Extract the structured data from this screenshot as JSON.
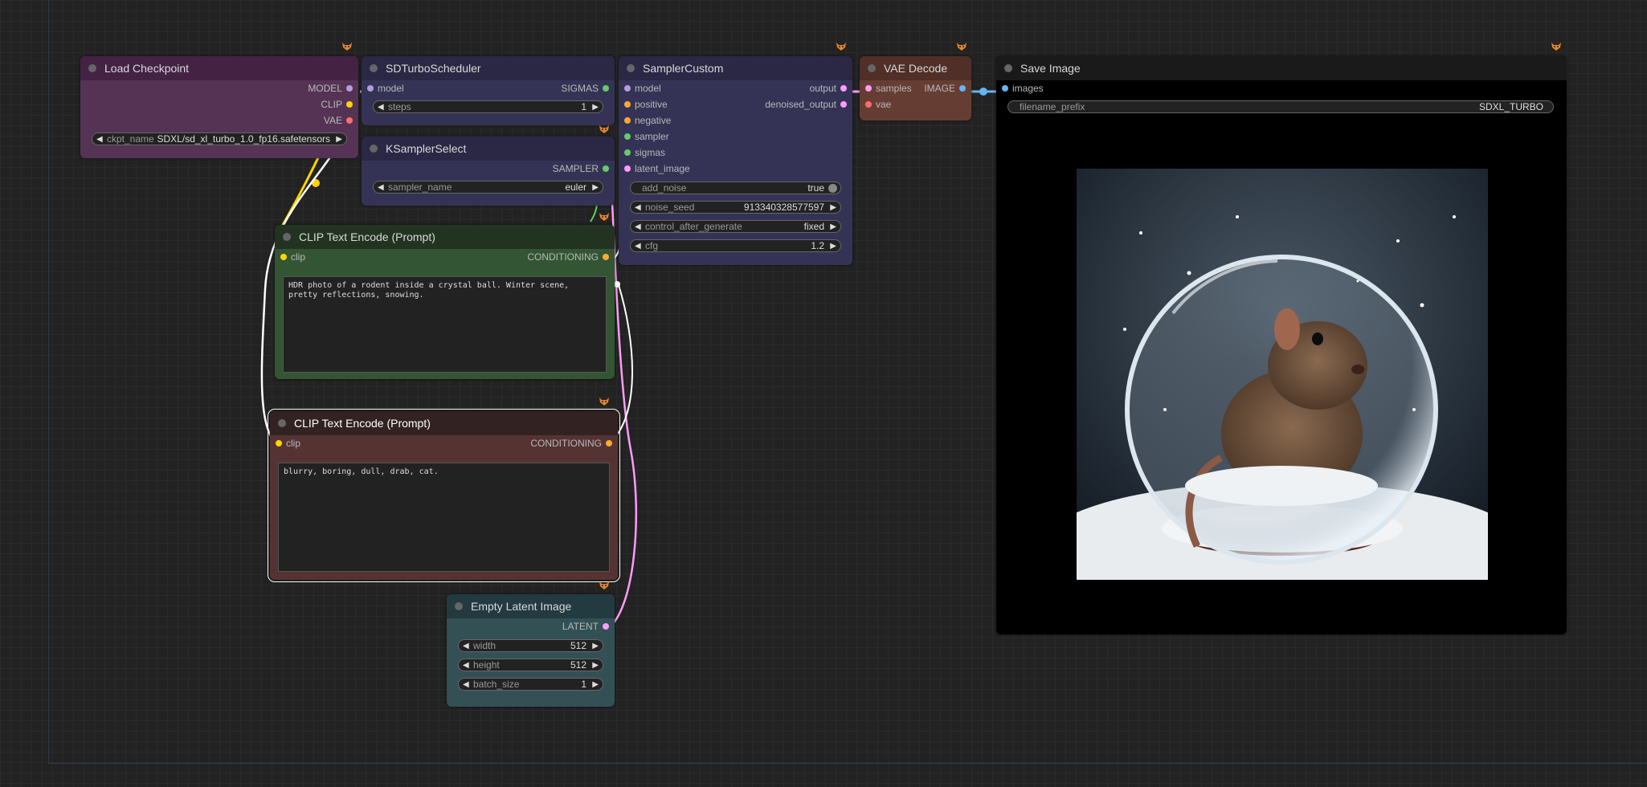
{
  "nodes": {
    "load_checkpoint": {
      "title": "Load Checkpoint",
      "outputs": [
        "MODEL",
        "CLIP",
        "VAE"
      ],
      "widget": {
        "name": "ckpt_name",
        "value": "SDXL/sd_xl_turbo_1.0_fp16.safetensors"
      }
    },
    "sd_turbo_scheduler": {
      "title": "SDTurboScheduler",
      "input": "model",
      "output": "SIGMAS",
      "widget": {
        "name": "steps",
        "value": "1"
      }
    },
    "ksampler_select": {
      "title": "KSamplerSelect",
      "output": "SAMPLER",
      "widget": {
        "name": "sampler_name",
        "value": "euler"
      }
    },
    "sampler_custom": {
      "title": "SamplerCustom",
      "inputs": [
        "model",
        "positive",
        "negative",
        "sampler",
        "sigmas",
        "latent_image"
      ],
      "outputs": [
        "output",
        "denoised_output"
      ],
      "widgets": [
        {
          "name": "add_noise",
          "value": "true"
        },
        {
          "name": "noise_seed",
          "value": "913340328577597"
        },
        {
          "name": "control_after_generate",
          "value": "fixed"
        },
        {
          "name": "cfg",
          "value": "1.2"
        }
      ]
    },
    "vae_decode": {
      "title": "VAE Decode",
      "inputs": [
        "samples",
        "vae"
      ],
      "output": "IMAGE"
    },
    "save_image": {
      "title": "Save Image",
      "input": "images",
      "widget": {
        "name": "filename_prefix",
        "value": "SDXL_TURBO"
      },
      "preview_icon": "snow-globe-rodent-image"
    },
    "clip_positive": {
      "title": "CLIP Text Encode (Prompt)",
      "input": "clip",
      "output": "CONDITIONING",
      "text": "HDR photo of a rodent inside a crystal ball. Winter scene, pretty reflections, snowing."
    },
    "clip_negative": {
      "title": "CLIP Text Encode (Prompt)",
      "input": "clip",
      "output": "CONDITIONING",
      "text": "blurry, boring, dull, drab, cat."
    },
    "empty_latent": {
      "title": "Empty Latent Image",
      "output": "LATENT",
      "widgets": [
        {
          "name": "width",
          "value": "512"
        },
        {
          "name": "height",
          "value": "512"
        },
        {
          "name": "batch_size",
          "value": "1"
        }
      ]
    }
  },
  "colors": {
    "canvas_bg": "#222222",
    "model_pin": "#b39ddb",
    "clip_pin": "#ffd500",
    "vae_pin": "#ff6e6e",
    "conditioning_pin": "#ffa931",
    "latent_pin": "#ff9cf9",
    "image_pin": "#64b5f6",
    "sigmas_pin": "#66cc66"
  },
  "badge_icon": "fox-badge-icon"
}
